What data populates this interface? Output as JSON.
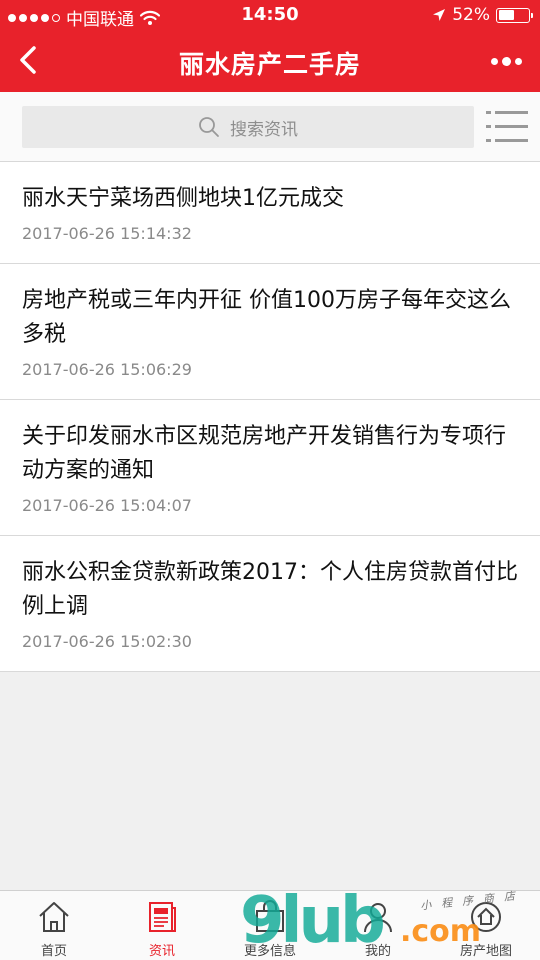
{
  "status_bar": {
    "carrier": "中国联通",
    "time": "14:50",
    "battery": "52%",
    "battery_level": 0.52
  },
  "nav": {
    "title": "丽水房产二手房",
    "back_icon": "chevron-left-icon",
    "more_icon": "more-dots-icon"
  },
  "search": {
    "placeholder": "搜索资讯",
    "menu_icon": "list-menu-icon"
  },
  "news": [
    {
      "title": "丽水天宁菜场西侧地块1亿元成交",
      "time": "2017-06-26 15:14:32"
    },
    {
      "title": "房地产税或三年内开征 价值100万房子每年交这么多税",
      "time": "2017-06-26 15:06:29"
    },
    {
      "title": "关于印发丽水市区规范房地产开发销售行为专项行动方案的通知",
      "time": "2017-06-26 15:04:07"
    },
    {
      "title": "丽水公积金贷款新政策2017：个人住房贷款首付比例上调",
      "time": "2017-06-26 15:02:30"
    }
  ],
  "tabs": [
    {
      "label": "首页",
      "icon": "home-icon"
    },
    {
      "label": "资讯",
      "icon": "newspaper-icon"
    },
    {
      "label": "更多信息",
      "icon": "bag-icon"
    },
    {
      "label": "我的",
      "icon": "user-icon"
    },
    {
      "label": "房产地图",
      "icon": "map-icon"
    }
  ],
  "colors": {
    "brand_red": "#e8222b"
  },
  "watermark": {
    "main": "9lub",
    "domain": ".com",
    "sub": "小程序商店"
  }
}
